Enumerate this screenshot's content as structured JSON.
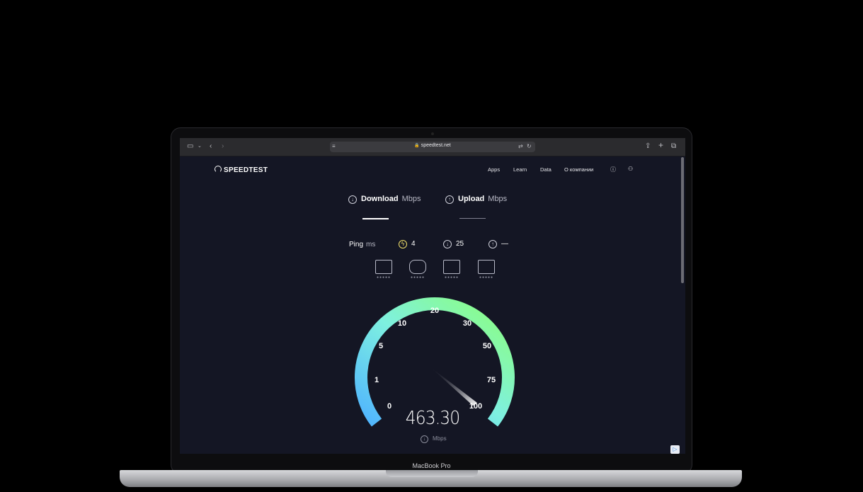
{
  "browser": {
    "url": "speedtest.net"
  },
  "site": {
    "logo": "SPEEDTEST",
    "nav": [
      "Apps",
      "Learn",
      "Data",
      "О компании"
    ]
  },
  "tabs": {
    "download_label": "Download",
    "download_unit": "Mbps",
    "upload_label": "Upload",
    "upload_unit": "Mbps"
  },
  "ping": {
    "label": "Ping",
    "unit": "ms",
    "idle": "4",
    "download": "25",
    "upload": "—"
  },
  "gauge": {
    "ticks": [
      "0",
      "1",
      "5",
      "10",
      "20",
      "30",
      "50",
      "75",
      "100"
    ],
    "value": "463.30",
    "unit": "Mbps",
    "colors": {
      "start": "#4fb3ff",
      "mid": "#7ef0e0",
      "end": "#8dff7a"
    }
  },
  "device": {
    "model": "MacBook Pro"
  }
}
